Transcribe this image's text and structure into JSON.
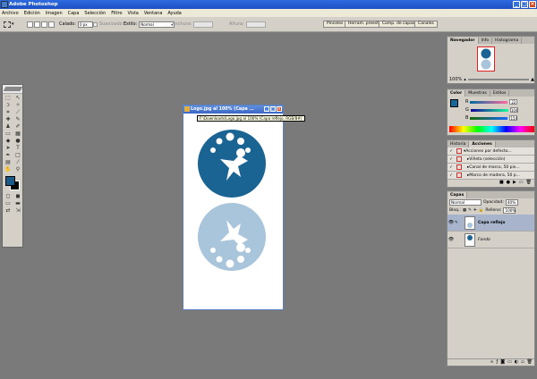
{
  "window": {
    "title": "Adobe Photoshop"
  },
  "menu": [
    "Archivo",
    "Edición",
    "Imagen",
    "Capa",
    "Selección",
    "Filtro",
    "Vista",
    "Ventana",
    "Ayuda"
  ],
  "options": {
    "calado_label": "Calado:",
    "calado_value": "0 px",
    "suavizado_label": "Suavizado",
    "estilo_label": "Estilo:",
    "estilo_value": "Normal",
    "anchura_label": "Anchura:",
    "altura_label": "Altura:",
    "wells": [
      "Pinceles",
      "Herram. preest.",
      "Comp. de capas",
      "Canales"
    ]
  },
  "document": {
    "title": "Logo.jpg al 100% (Capa ...",
    "tooltip": "F:\\Downloads\\Logo.jpg al 100% (Capa reflejo, RGB/8#)"
  },
  "navigator": {
    "tabs": [
      "Navegador",
      "Info",
      "Histograma"
    ],
    "zoom": "100%"
  },
  "color_panel": {
    "tabs": [
      "Color",
      "Muestras",
      "Estilos"
    ],
    "r": {
      "label": "R",
      "value": "22"
    },
    "g": {
      "label": "G",
      "value": "104"
    },
    "b": {
      "label": "B",
      "value": "154"
    }
  },
  "history": {
    "tabs": [
      "Historia",
      "Acciones"
    ],
    "items": [
      "Acciones por defecto...",
      "Viñeta (selección)",
      "Canal de marco, 50 pix...",
      "Marco de madera, 50 p..."
    ]
  },
  "layers": {
    "tabs": [
      "Capas"
    ],
    "blend": "Normal",
    "opacity_label": "Opacidad:",
    "opacity": "40%",
    "lock_label": "Bloq.:",
    "fill_label": "Relleno:",
    "fill": "100%",
    "items": [
      {
        "name": "Capa reflejo",
        "selected": true
      },
      {
        "name": "Fondo",
        "selected": false
      }
    ]
  },
  "colors": {
    "foreground": "#16689a",
    "logo_dark": "#1a6494",
    "logo_light": "#a9c5dc"
  }
}
